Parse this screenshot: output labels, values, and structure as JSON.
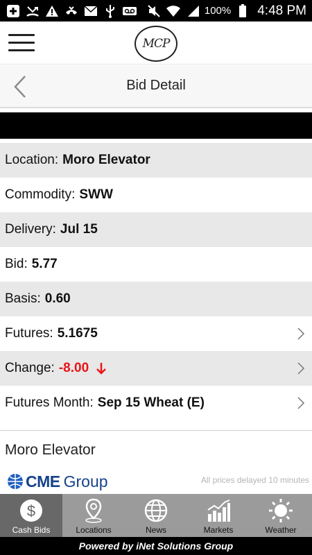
{
  "status_bar": {
    "battery": "100%",
    "time": "4:48 PM",
    "icons": [
      "plus-icon",
      "missed-call-icon",
      "warning-icon",
      "voicemail-handset-icon",
      "mail-icon",
      "usb-icon",
      "voicemail-icon",
      "mute-icon",
      "wifi-icon",
      "signal-icon",
      "battery-icon"
    ]
  },
  "header": {
    "logo_text": "MCP",
    "menu_icon": "hamburger-menu-icon"
  },
  "titlebar": {
    "title": "Bid Detail",
    "back_icon": "chevron-left-icon"
  },
  "details": [
    {
      "label": "Location:",
      "value": "Moro Elevator"
    },
    {
      "label": "Commodity:",
      "value": "SWW"
    },
    {
      "label": "Delivery:",
      "value": "Jul 15"
    },
    {
      "label": "Bid:",
      "value": "5.77"
    },
    {
      "label": "Basis:",
      "value": "0.60"
    },
    {
      "label": "Futures:",
      "value": "5.1675"
    },
    {
      "label": "Change:",
      "value": "-8.00"
    },
    {
      "label": "Futures Month:",
      "value": "Sep 15 Wheat (E)"
    }
  ],
  "colors": {
    "negative": "#e8141b",
    "tab_bar": "#9b9b9b",
    "tab_active": "#686868",
    "cme_blue": "#16428a"
  },
  "location_name": "Moro Elevator",
  "cme_logo": {
    "brand": "CME",
    "suffix": "Group"
  },
  "delay_note": "All prices delayed 10 minutes",
  "tabs": [
    {
      "label": "Cash Bids",
      "icon": "dollar-icon"
    },
    {
      "label": "Locations",
      "icon": "map-pin-icon"
    },
    {
      "label": "News",
      "icon": "globe-icon"
    },
    {
      "label": "Markets",
      "icon": "bar-chart-icon"
    },
    {
      "label": "Weather",
      "icon": "sun-icon"
    }
  ],
  "footer": "Powered by iNet Solutions Group"
}
